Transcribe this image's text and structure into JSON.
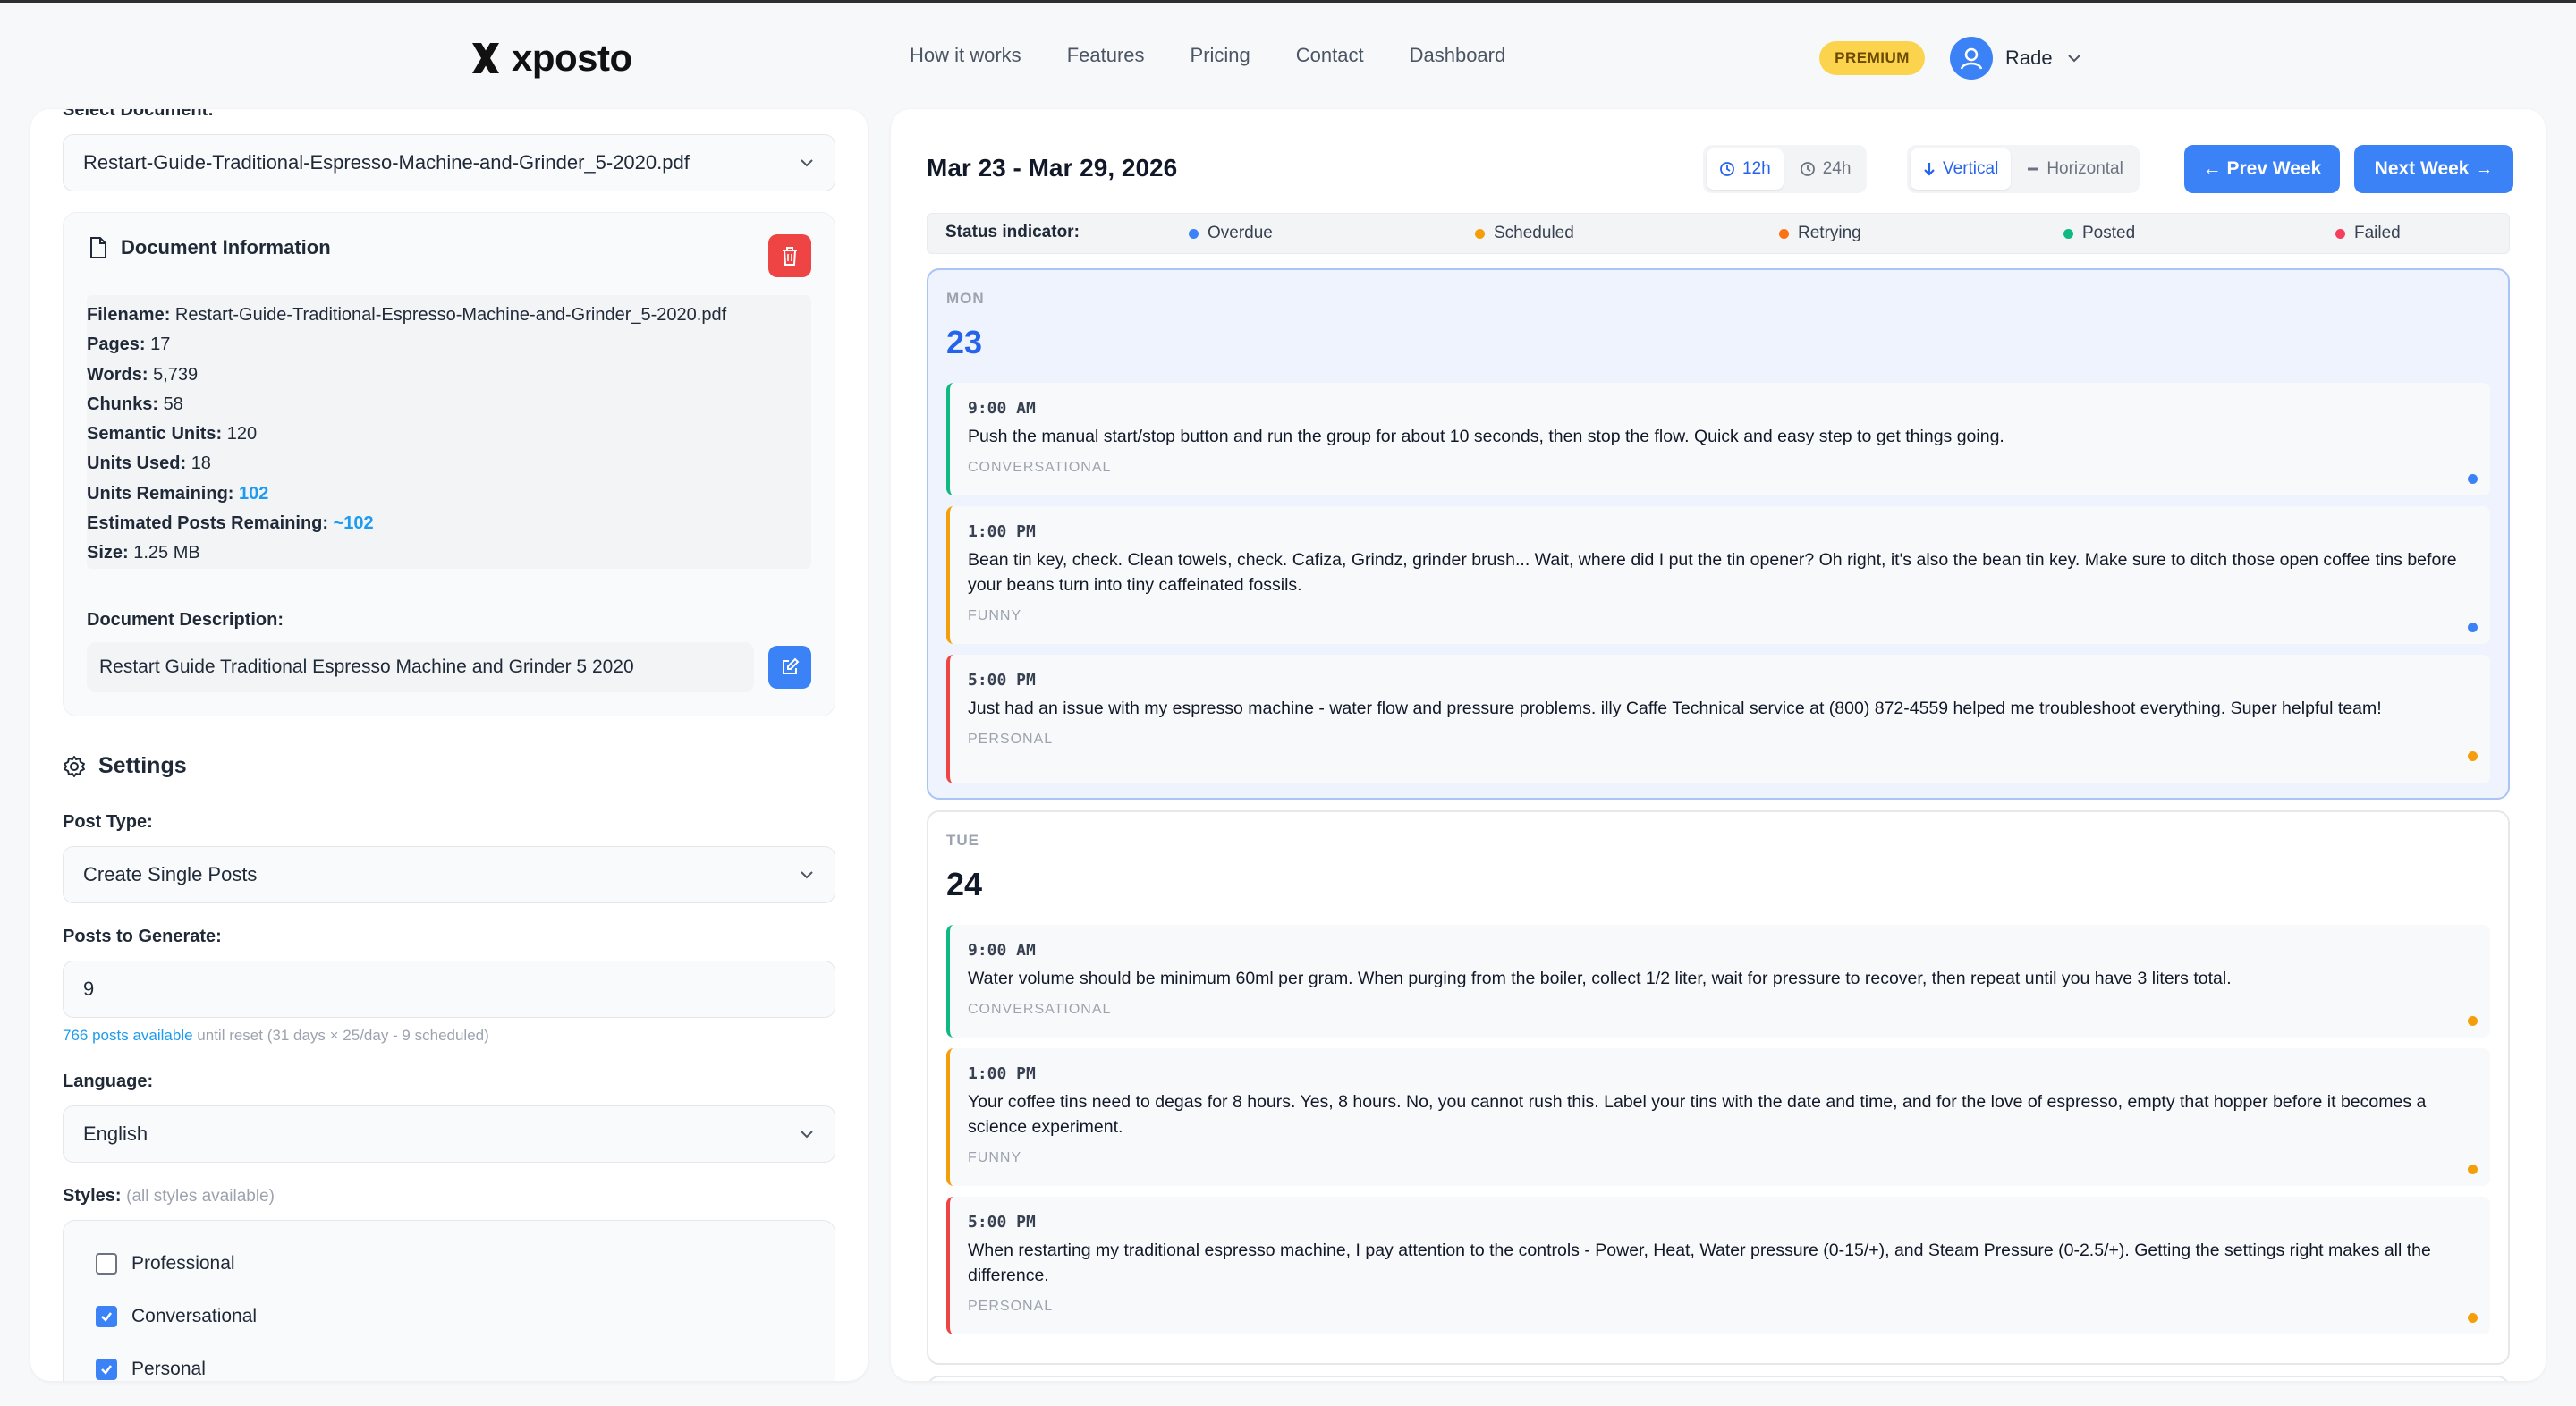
{
  "header": {
    "logo_text": "xposto",
    "nav": [
      "How it works",
      "Features",
      "Pricing",
      "Contact",
      "Dashboard"
    ],
    "premium_badge": "PREMIUM",
    "user_name": "Rade"
  },
  "left": {
    "select_document_label": "Select Document:",
    "selected_document": "Restart-Guide-Traditional-Espresso-Machine-and-Grinder_5-2020.pdf",
    "doc_info": {
      "title": "Document Information",
      "rows": [
        {
          "label": "Filename:",
          "value": "Restart-Guide-Traditional-Espresso-Machine-and-Grinder_5-2020.pdf"
        },
        {
          "label": "Pages:",
          "value": "17"
        },
        {
          "label": "Words:",
          "value": "5,739"
        },
        {
          "label": "Chunks:",
          "value": "58"
        },
        {
          "label": "Semantic Units:",
          "value": "120"
        },
        {
          "label": "Units Used:",
          "value": "18"
        },
        {
          "label": "Units Remaining:",
          "value": "102"
        },
        {
          "label": "Estimated Posts Remaining:",
          "value": "~102"
        },
        {
          "label": "Size:",
          "value": "1.25 MB"
        }
      ],
      "description_label": "Document Description:",
      "description_value": "Restart Guide Traditional Espresso Machine and Grinder 5 2020"
    },
    "settings": {
      "title": "Settings",
      "post_type_label": "Post Type:",
      "post_type_value": "Create Single Posts",
      "posts_to_generate_label": "Posts to Generate:",
      "posts_to_generate_value": "9",
      "available_link": "766 posts available",
      "available_rest": "until reset (31 days × 25/day - 9 scheduled)",
      "language_label": "Language:",
      "language_value": "English",
      "styles_label": "Styles:",
      "styles_note": "(all styles available)",
      "styles": [
        {
          "label": "Professional",
          "checked": false
        },
        {
          "label": "Conversational",
          "checked": true
        },
        {
          "label": "Personal",
          "checked": true
        }
      ]
    }
  },
  "calendar": {
    "range_title": "Mar 23 - Mar 29, 2026",
    "time_12h": "12h",
    "time_24h": "24h",
    "vertical": "Vertical",
    "horizontal": "Horizontal",
    "prev_week": "← Prev Week",
    "next_week": "Next Week →",
    "status_label": "Status indicator:",
    "statuses": [
      {
        "label": "Overdue",
        "color": "#3b82f6"
      },
      {
        "label": "Scheduled",
        "color": "#f59e0b"
      },
      {
        "label": "Retrying",
        "color": "#f97316"
      },
      {
        "label": "Posted",
        "color": "#10b981"
      },
      {
        "label": "Failed",
        "color": "#f43f5e"
      }
    ],
    "days": [
      {
        "name": "MON",
        "num": "23",
        "posts": [
          {
            "time": "9:00 AM",
            "text": "Push the manual start/stop button and run the group for about 10 seconds, then stop the flow. Quick and easy step to get things going.",
            "tag": "CONVERSATIONAL",
            "dot": "#3b82f6"
          },
          {
            "time": "1:00 PM",
            "text": "Bean tin key, check. Clean towels, check. Cafiza, Grindz, grinder brush... Wait, where did I put the tin opener? Oh right, it's also the bean tin key. Make sure to ditch those open coffee tins before your beans turn into tiny caffeinated fossils.",
            "tag": "FUNNY",
            "dot": "#3b82f6"
          },
          {
            "time": "5:00 PM",
            "text": "Just had an issue with my espresso machine - water flow and pressure problems. illy Caffe Technical service at (800) 872-4559 helped me troubleshoot everything. Super helpful team!",
            "tag": "PERSONAL",
            "dot": "#f59e0b"
          }
        ]
      },
      {
        "name": "TUE",
        "num": "24",
        "posts": [
          {
            "time": "9:00 AM",
            "text": "Water volume should be minimum 60ml per gram. When purging from the boiler, collect 1/2 liter, wait for pressure to recover, then repeat until you have 3 liters total.",
            "tag": "CONVERSATIONAL",
            "dot": "#f59e0b"
          },
          {
            "time": "1:00 PM",
            "text": "Your coffee tins need to degas for 8 hours. Yes, 8 hours. No, you cannot rush this. Label your tins with the date and time, and for the love of espresso, empty that hopper before it becomes a science experiment.",
            "tag": "FUNNY",
            "dot": "#f59e0b"
          },
          {
            "time": "5:00 PM",
            "text": "When restarting my traditional espresso machine, I pay attention to the controls - Power, Heat, Water pressure (0-15/+), and Steam Pressure (0-2.5/+). Getting the settings right makes all the difference.",
            "tag": "PERSONAL",
            "dot": "#f59e0b"
          }
        ]
      }
    ]
  }
}
